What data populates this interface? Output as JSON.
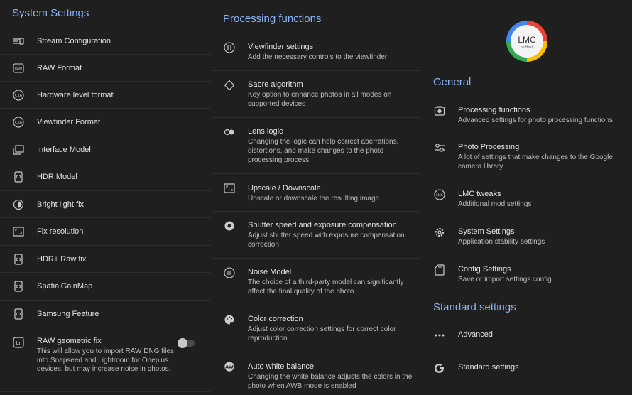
{
  "left": {
    "title": "System Settings",
    "items": [
      {
        "label": "Stream Configuration",
        "icon": "stream-config-icon"
      },
      {
        "label": "RAW Format",
        "icon": "raw-icon"
      },
      {
        "label": "Hardware level format",
        "icon": "c2a-icon"
      },
      {
        "label": "Viewfinder Format",
        "icon": "c2a-icon"
      },
      {
        "label": "Interface Model",
        "icon": "windows-icon"
      },
      {
        "label": "HDR Model",
        "icon": "code-icon"
      },
      {
        "label": "Bright light fix",
        "icon": "brightness-icon"
      },
      {
        "label": "Fix resolution",
        "icon": "crop-icon"
      },
      {
        "label": "HDR+ Raw fix",
        "icon": "code-icon"
      },
      {
        "label": "SpatialGainMap",
        "icon": "code-icon"
      },
      {
        "label": "Samsung Feature",
        "icon": "code-icon"
      },
      {
        "label": "RAW geometric fix",
        "icon": "lightroom-icon",
        "desc": "This will allow you to import RAW DNG files into Snapseed and Lightroom for Oneplus devices, but may increase noise in photos.",
        "toggle": false
      }
    ]
  },
  "middle": {
    "title": "Processing functions",
    "items": [
      {
        "label": "Viewfinder settings",
        "desc": "Add the necessary controls to the viewfinder",
        "icon": "viewfinder-icon"
      },
      {
        "label": "Sabre algorithm",
        "desc": "Key option to enhance photos in all modes on supported devices",
        "icon": "diamond-icon"
      },
      {
        "label": "Lens logic",
        "desc": "Changing the logic can help correct aberrations, distortions, and make changes to the photo processing process.",
        "icon": "lens-icon"
      },
      {
        "label": "Upscale / Downscale",
        "desc": "Upscale or downscale the resulting image",
        "icon": "upscale-icon"
      },
      {
        "label": "Shutter speed and exposure compensation",
        "desc": "Adjust shutter speed with exposure compensation correction",
        "icon": "shutter-icon"
      },
      {
        "label": "Noise Model",
        "desc": "The choice of a third-party model can significantly affect the final quality of the photo",
        "icon": "noise-icon"
      },
      {
        "label": "Color correction",
        "desc": "Adjust color correction settings for correct color reproduction",
        "icon": "palette-icon"
      },
      {
        "label": "Auto white balance",
        "desc": "Changing the white balance adjusts the colors in the photo when AWB mode is enabled",
        "icon": "awb-icon"
      }
    ]
  },
  "right": {
    "logo_text": "LMC",
    "logo_sub": "by Hasli",
    "general_title": "General",
    "general_items": [
      {
        "label": "Processing functions",
        "desc": "Advanced settings for photo processing functions",
        "icon": "camera-icon"
      },
      {
        "label": "Photo Processing",
        "desc": "A lot of settings that make changes to the Google camera library",
        "icon": "sliders-icon"
      },
      {
        "label": "LMC tweaks",
        "desc": "Additional mod settings",
        "icon": "lmc-icon"
      },
      {
        "label": "System Settings",
        "desc": "Application stability settings",
        "icon": "gear-icon"
      },
      {
        "label": "Config Settings",
        "desc": "Save or import settings config",
        "icon": "sd-card-icon"
      }
    ],
    "standard_title": "Standard settings",
    "standard_items": [
      {
        "label": "Advanced",
        "icon": "more-icon"
      },
      {
        "label": "Standard settings",
        "icon": "google-icon"
      }
    ]
  },
  "colors": {
    "background": "#1f1f1f",
    "accent": "#8ab4f8",
    "text": "#e3e3e3",
    "secondary_text": "#bdbdbd"
  }
}
